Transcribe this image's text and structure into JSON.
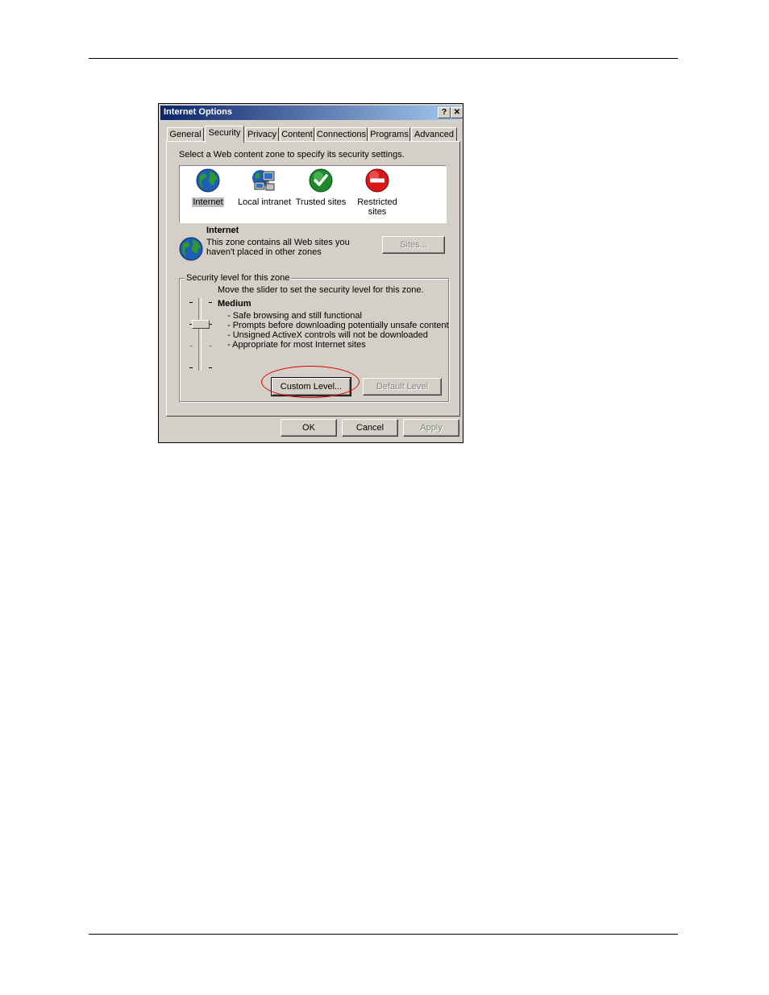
{
  "dialog": {
    "title": "Internet Options",
    "help_glyph": "?",
    "close_glyph": "✕"
  },
  "tabs": [
    {
      "label": "General"
    },
    {
      "label": "Security"
    },
    {
      "label": "Privacy"
    },
    {
      "label": "Content"
    },
    {
      "label": "Connections"
    },
    {
      "label": "Programs"
    },
    {
      "label": "Advanced"
    }
  ],
  "security": {
    "instruction": "Select a Web content zone to specify its security settings.",
    "zones": [
      {
        "line1": "Internet",
        "line2": "",
        "icon": "globe-icon"
      },
      {
        "line1": "Local intranet",
        "line2": "",
        "icon": "network-icon"
      },
      {
        "line1": "Trusted sites",
        "line2": "",
        "icon": "checkmark-icon"
      },
      {
        "line1": "Restricted",
        "line2": "sites",
        "icon": "no-entry-icon"
      }
    ],
    "selected_zone": {
      "name": "Internet",
      "desc_line1": "This zone contains all Web sites you",
      "desc_line2": "haven't placed in other zones"
    },
    "sites_button": "Sites...",
    "level_group_label": "Security level for this zone",
    "slider_hint": "Move the slider to set the security level for this zone.",
    "level_name": "Medium",
    "level_bullets": [
      "- Safe browsing and still functional",
      "- Prompts before downloading potentially unsafe content",
      "- Unsigned ActiveX controls will not be downloaded",
      "- Appropriate for most Internet sites"
    ],
    "custom_level_button": "Custom Level...",
    "default_level_button": "Default Level"
  },
  "footer": {
    "ok": "OK",
    "cancel": "Cancel",
    "apply": "Apply"
  },
  "colors": {
    "titlebar_start": "#0a246a",
    "titlebar_end": "#a6caf0",
    "face": "#d4d0c8",
    "highlight_ellipse": "#e00000"
  }
}
